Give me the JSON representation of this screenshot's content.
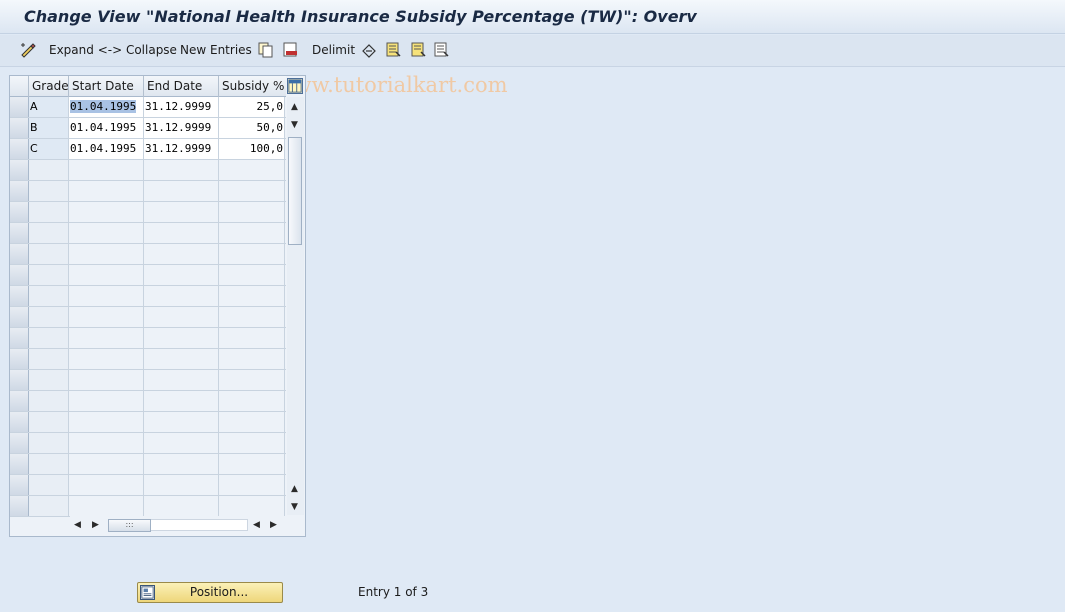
{
  "window": {
    "title": "Change View \"National Health Insurance Subsidy Percentage (TW)\": Overv"
  },
  "toolbar": {
    "expand_collapse_label": "Expand <-> Collapse",
    "new_entries_label": "New Entries",
    "delimit_label": "Delimit",
    "watermark": "© www.tutorialkart.com"
  },
  "table": {
    "headers": {
      "grade": "Grade",
      "start_date": "Start Date",
      "end_date": "End Date",
      "subsidy": "Subsidy %"
    },
    "rows": [
      {
        "grade": "A",
        "start_date": "01.04.1995",
        "end_date": "31.12.9999",
        "subsidy": "25,0"
      },
      {
        "grade": "B",
        "start_date": "01.04.1995",
        "end_date": "31.12.9999",
        "subsidy": "50,0"
      },
      {
        "grade": "C",
        "start_date": "01.04.1995",
        "end_date": "31.12.9999",
        "subsidy": "100,0"
      }
    ]
  },
  "footer": {
    "position_button_label": "Position...",
    "entry_info": "Entry 1 of 3"
  },
  "colors": {
    "background": "#dfe9f5",
    "button_yellow": "#eed67a",
    "selection": "#a9c2e4"
  }
}
